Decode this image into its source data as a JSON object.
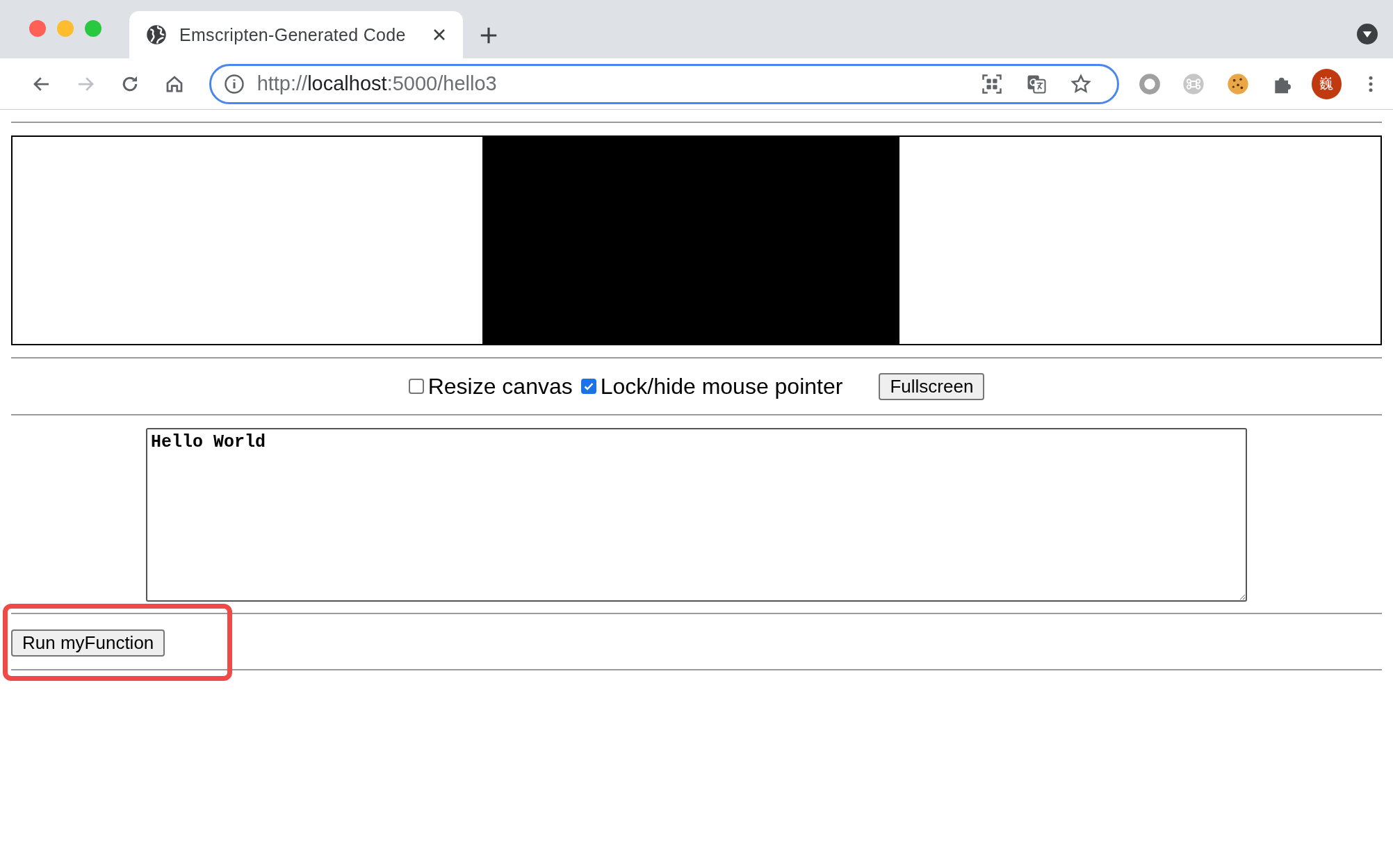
{
  "browser": {
    "tab": {
      "title": "Emscripten-Generated Code",
      "selected": true
    },
    "url": {
      "scheme": "http://",
      "host": "localhost",
      "path": ":5000/hello3"
    },
    "avatar_text": "巍"
  },
  "page": {
    "options": [
      {
        "label": "Resize canvas",
        "checked": false
      },
      {
        "label": "Lock/hide mouse pointer",
        "checked": true
      }
    ],
    "fullscreen_button": "Fullscreen",
    "output": {
      "value": "Hello World"
    },
    "run_button": "Run myFunction"
  }
}
